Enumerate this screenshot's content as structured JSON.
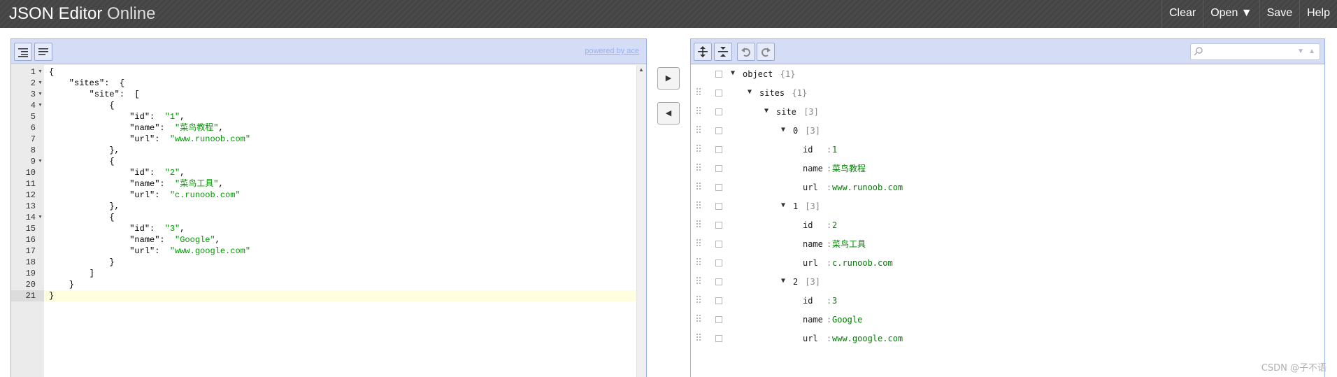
{
  "header": {
    "title_bold": "JSON Editor",
    "title_light": "Online",
    "menu": {
      "clear": "Clear",
      "open": "Open ▼",
      "save": "Save",
      "help": "Help"
    }
  },
  "code_panel": {
    "powered_by": "powered by ace",
    "toolbar_icons": [
      "format-icon",
      "compact-icon"
    ],
    "line_numbers": [
      "1",
      "2",
      "3",
      "4",
      "5",
      "6",
      "7",
      "8",
      "9",
      "10",
      "11",
      "12",
      "13",
      "14",
      "15",
      "16",
      "17",
      "18",
      "19",
      "20",
      "21"
    ],
    "fold_lines": [
      1,
      2,
      3,
      4,
      9,
      14
    ],
    "active_line": 21,
    "lines": [
      "{",
      "    \"sites\":  {",
      "        \"site\":  [",
      "            {",
      "                \"id\":  \"1\",",
      "                \"name\":  \"菜鸟教程\",",
      "                \"url\":  \"www.runoob.com\"",
      "            },",
      "            {",
      "                \"id\":  \"2\",",
      "                \"name\":  \"菜鸟工具\",",
      "                \"url\":  \"c.runoob.com\"",
      "            },",
      "            {",
      "                \"id\":  \"3\",",
      "                \"name\":  \"Google\",",
      "                \"url\":  \"www.google.com\"",
      "            }",
      "        ]",
      "    }",
      "}"
    ]
  },
  "transfer_buttons": {
    "to_tree": "▶",
    "to_code": "◀"
  },
  "tree_panel": {
    "toolbar_icons": [
      "expand-all-icon",
      "collapse-all-icon",
      "undo-icon",
      "redo-icon"
    ],
    "search_placeholder": "",
    "rows": [
      {
        "level": 0,
        "expand": "▼",
        "key": "object",
        "count": "{1}",
        "draggable": false
      },
      {
        "level": 1,
        "expand": "▼",
        "key": "sites",
        "count": "{1}",
        "draggable": true
      },
      {
        "level": 2,
        "expand": "▼",
        "key": "site",
        "count": "[3]",
        "draggable": true
      },
      {
        "level": 3,
        "expand": "▼",
        "key": "0",
        "count": "[3]",
        "draggable": true
      },
      {
        "level": 4,
        "key": "id",
        "sep": ":",
        "value": "1",
        "draggable": true
      },
      {
        "level": 4,
        "key": "name",
        "sep": ":",
        "value": "菜鸟教程",
        "draggable": true
      },
      {
        "level": 4,
        "key": "url",
        "sep": ":",
        "value": "www.runoob.com",
        "draggable": true
      },
      {
        "level": 3,
        "expand": "▼",
        "key": "1",
        "count": "[3]",
        "draggable": true
      },
      {
        "level": 4,
        "key": "id",
        "sep": ":",
        "value": "2",
        "draggable": true
      },
      {
        "level": 4,
        "key": "name",
        "sep": ":",
        "value": "菜鸟工具",
        "draggable": true
      },
      {
        "level": 4,
        "key": "url",
        "sep": ":",
        "value": "c.runoob.com",
        "draggable": true
      },
      {
        "level": 3,
        "expand": "▼",
        "key": "2",
        "count": "[3]",
        "draggable": true
      },
      {
        "level": 4,
        "key": "id",
        "sep": ":",
        "value": "3",
        "draggable": true
      },
      {
        "level": 4,
        "key": "name",
        "sep": ":",
        "value": "Google",
        "draggable": true
      },
      {
        "level": 4,
        "key": "url",
        "sep": ":",
        "value": "www.google.com",
        "draggable": true
      }
    ]
  },
  "watermark": "CSDN @子不语",
  "colors": {
    "panel_border": "#97b0f8",
    "toolbar_bg": "#d5ddf6",
    "string_value": "#008000",
    "header_bg": "#474747"
  }
}
